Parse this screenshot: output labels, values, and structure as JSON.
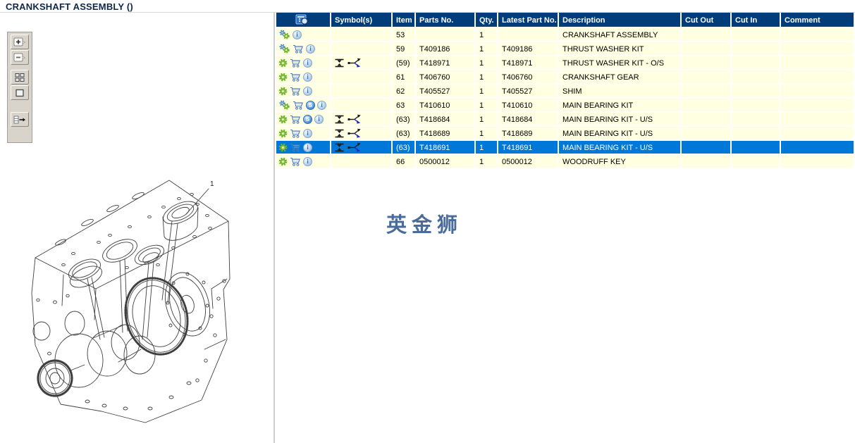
{
  "header": {
    "title": "CRANKSHAFT ASSEMBLY ()"
  },
  "watermark": "英金狮",
  "drawing": {
    "callout_label": "1"
  },
  "toolbar": {
    "buttons": [
      {
        "name": "zoom-in"
      },
      {
        "name": "zoom-out"
      },
      {
        "name": "tile-view"
      },
      {
        "name": "fit-view"
      },
      {
        "name": "export-list"
      }
    ]
  },
  "table": {
    "headers": {
      "icons_header_icon": "catalog-preview-icon",
      "symbols": "Symbol(s)",
      "item": "Item",
      "parts_no": "Parts No.",
      "qty": "Qty.",
      "latest_part_no": "Latest Part No.",
      "description": "Description",
      "cut_out": "Cut Out",
      "cut_in": "Cut In",
      "comment": "Comment"
    },
    "rows": [
      {
        "icons": [
          "add-gears",
          "info"
        ],
        "symbols": [],
        "item": "53",
        "parts_no": "",
        "qty": "1",
        "latest_part_no": "",
        "description": "CRANKSHAFT ASSEMBLY",
        "cut_out": "",
        "cut_in": "",
        "comment": "",
        "selected": false
      },
      {
        "icons": [
          "add-gears",
          "cart",
          "info"
        ],
        "symbols": [],
        "item": "59",
        "parts_no": "T409186",
        "qty": "1",
        "latest_part_no": "T409186",
        "description": "THRUST WASHER KIT",
        "cut_out": "",
        "cut_in": "",
        "comment": "",
        "selected": false
      },
      {
        "icons": [
          "gear",
          "cart",
          "info"
        ],
        "symbols": [
          "oversize",
          "alternative"
        ],
        "item": "(59)",
        "parts_no": "T418971",
        "qty": "1",
        "latest_part_no": "T418971",
        "description": "THRUST WASHER KIT - O/S",
        "cut_out": "",
        "cut_in": "",
        "comment": "",
        "selected": false
      },
      {
        "icons": [
          "gear",
          "cart",
          "info"
        ],
        "symbols": [],
        "item": "61",
        "parts_no": "T406760",
        "qty": "1",
        "latest_part_no": "T406760",
        "description": "CRANKSHAFT GEAR",
        "cut_out": "",
        "cut_in": "",
        "comment": "",
        "selected": false
      },
      {
        "icons": [
          "gear",
          "cart",
          "info"
        ],
        "symbols": [],
        "item": "62",
        "parts_no": "T405527",
        "qty": "1",
        "latest_part_no": "T405527",
        "description": "SHIM",
        "cut_out": "",
        "cut_in": "",
        "comment": "",
        "selected": false
      },
      {
        "icons": [
          "add-gears",
          "cart",
          "s-badge",
          "info"
        ],
        "symbols": [],
        "item": "63",
        "parts_no": "T410610",
        "qty": "1",
        "latest_part_no": "T410610",
        "description": "MAIN BEARING KIT",
        "cut_out": "",
        "cut_in": "",
        "comment": "",
        "selected": false
      },
      {
        "icons": [
          "gear",
          "cart",
          "s-badge",
          "info"
        ],
        "symbols": [
          "oversize",
          "alternative"
        ],
        "item": "(63)",
        "parts_no": "T418684",
        "qty": "1",
        "latest_part_no": "T418684",
        "description": "MAIN BEARING KIT - U/S",
        "cut_out": "",
        "cut_in": "",
        "comment": "",
        "selected": false
      },
      {
        "icons": [
          "gear",
          "cart",
          "info"
        ],
        "symbols": [
          "oversize",
          "alternative"
        ],
        "item": "(63)",
        "parts_no": "T418689",
        "qty": "1",
        "latest_part_no": "T418689",
        "description": "MAIN BEARING KIT - U/S",
        "cut_out": "",
        "cut_in": "",
        "comment": "",
        "selected": false
      },
      {
        "icons": [
          "gear",
          "cart",
          "info"
        ],
        "symbols": [
          "oversize",
          "alternative"
        ],
        "item": "(63)",
        "parts_no": "T418691",
        "qty": "1",
        "latest_part_no": "T418691",
        "description": "MAIN BEARING KIT - U/S",
        "cut_out": "",
        "cut_in": "",
        "comment": "",
        "selected": true
      },
      {
        "icons": [
          "gear",
          "cart",
          "info"
        ],
        "symbols": [],
        "item": "66",
        "parts_no": "0500012",
        "qty": "1",
        "latest_part_no": "0500012",
        "description": "WOODRUFF KEY",
        "cut_out": "",
        "cut_in": "",
        "comment": "",
        "selected": false
      }
    ]
  },
  "colors": {
    "header_bg": "#003d7a",
    "row_bg": "#ffffe1",
    "selected_bg": "#0078d7",
    "watermark": "#4a6c9b"
  }
}
